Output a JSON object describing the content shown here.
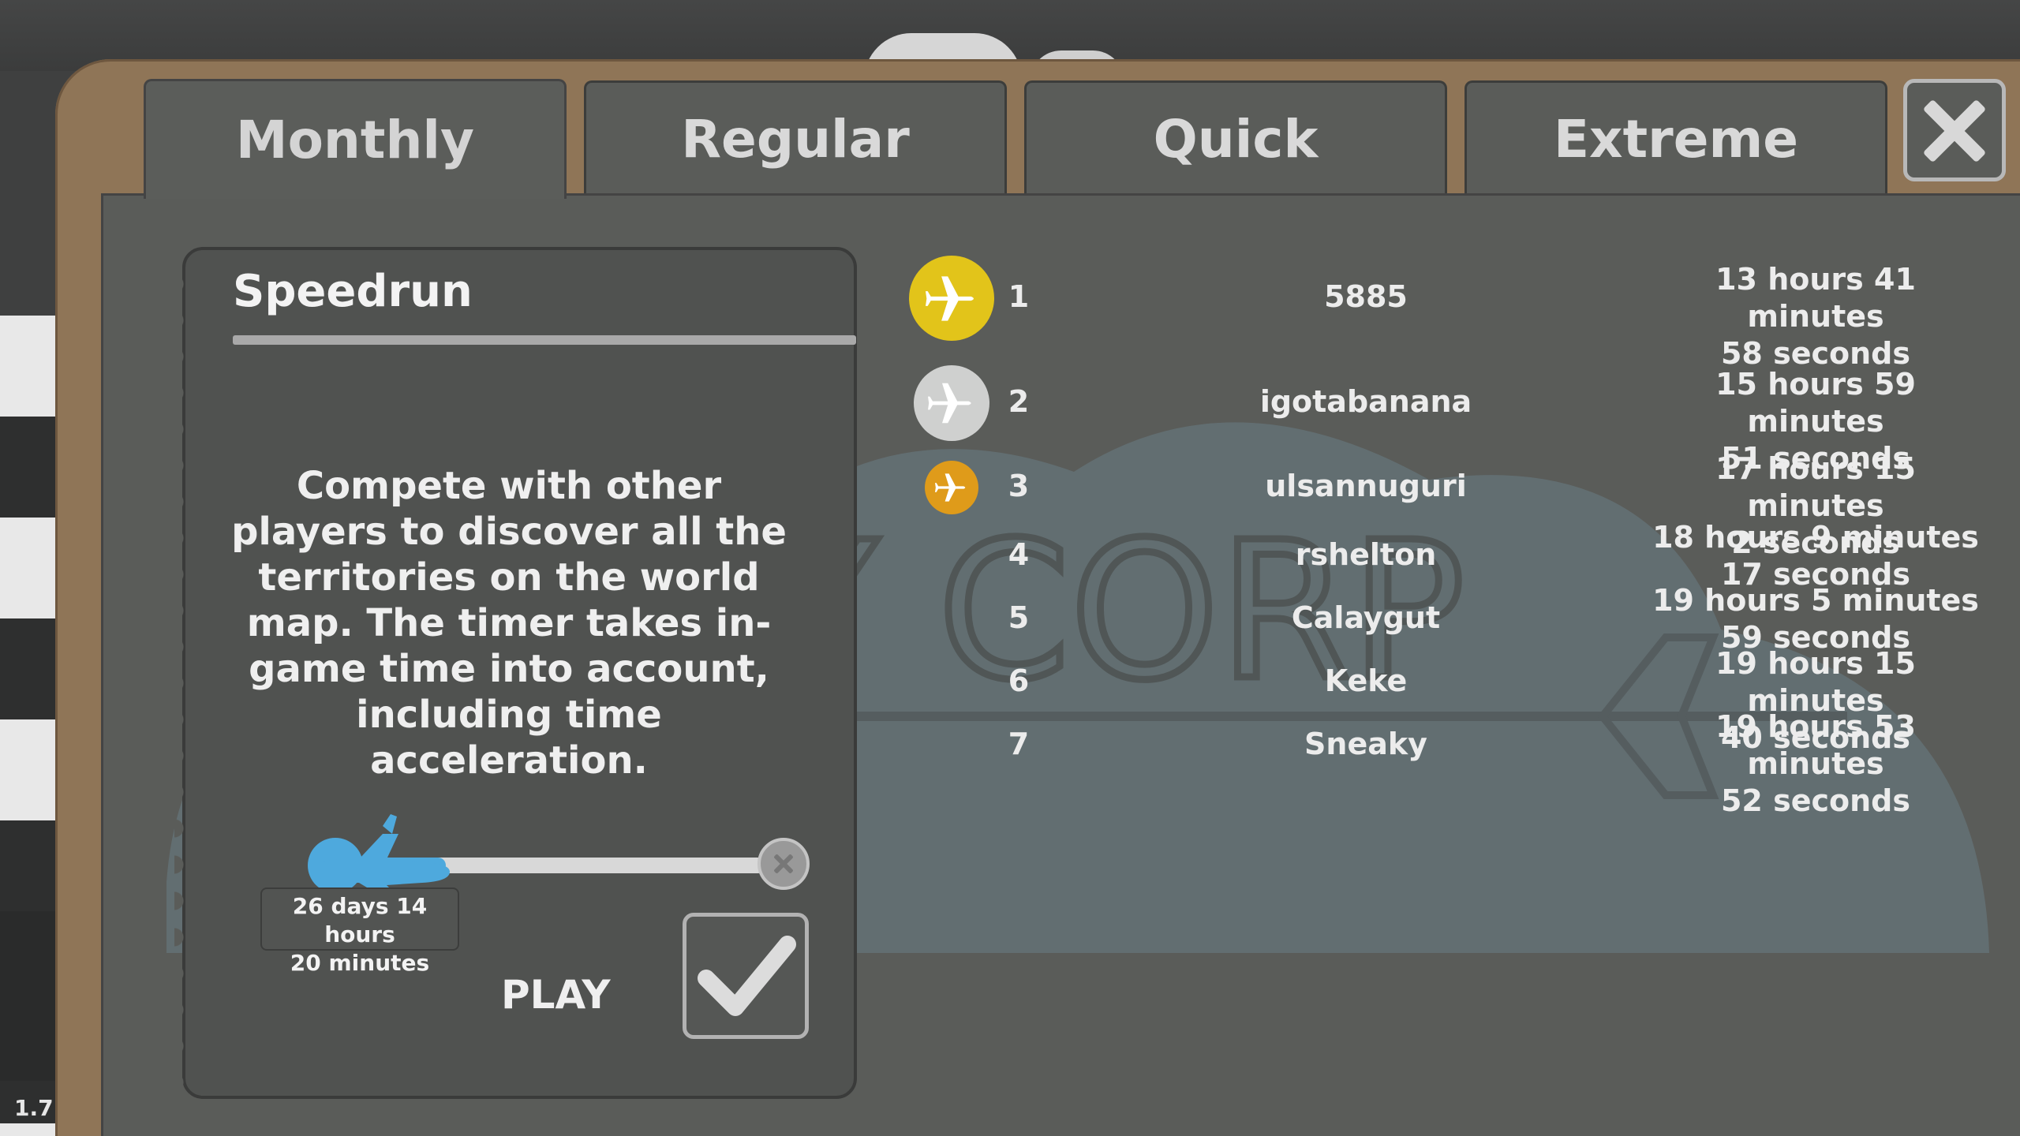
{
  "version": "1.7.",
  "tabs": [
    {
      "label": "Monthly",
      "active": true
    },
    {
      "label": "Regular",
      "active": false
    },
    {
      "label": "Quick",
      "active": false
    },
    {
      "label": "Extreme",
      "active": false
    }
  ],
  "card": {
    "title": "Speedrun",
    "description": "Compete with other players to discover all the territories on the world map. The timer takes in-game time into account, including time acceleration.",
    "slider_value": "26 days 14 hours 20 minutes",
    "slider_value_line1": "26 days 14 hours",
    "slider_value_line2": "20 minutes",
    "slider_progress": 0.0,
    "play_label": "PLAY"
  },
  "leaderboard": [
    {
      "rank": "1",
      "name": "5885",
      "time_line1": "13 hours 41 minutes",
      "time_line2": "58 seconds",
      "medal": "gold-medal-icon"
    },
    {
      "rank": "2",
      "name": "igotabanana",
      "time_line1": "15 hours 59 minutes",
      "time_line2": "51 seconds",
      "medal": "silver-medal-icon"
    },
    {
      "rank": "3",
      "name": "ulsannuguri",
      "time_line1": "17 hours 15 minutes",
      "time_line2": "2 seconds",
      "medal": "bronze-medal-icon"
    },
    {
      "rank": "4",
      "name": "rshelton",
      "time_line1": "18 hours 9 minutes",
      "time_line2": "17 seconds",
      "medal": ""
    },
    {
      "rank": "5",
      "name": "Calaygut",
      "time_line1": "19 hours 5 minutes",
      "time_line2": "59 seconds",
      "medal": ""
    },
    {
      "rank": "6",
      "name": "Keke",
      "time_line1": "19 hours 15 minutes",
      "time_line2": "40 seconds",
      "medal": ""
    },
    {
      "rank": "7",
      "name": "Sneaky",
      "time_line1": "19 hours 53 minutes",
      "time_line2": "52 seconds",
      "medal": ""
    }
  ],
  "watermark_text": "Y CORP",
  "colors": {
    "gold": "#e2c41a",
    "silver": "#cfd0cf",
    "bronze": "#df9b1a",
    "slider_blue": "#4ea9dd",
    "panel": "#5a5c59",
    "frame": "#8f7557"
  }
}
